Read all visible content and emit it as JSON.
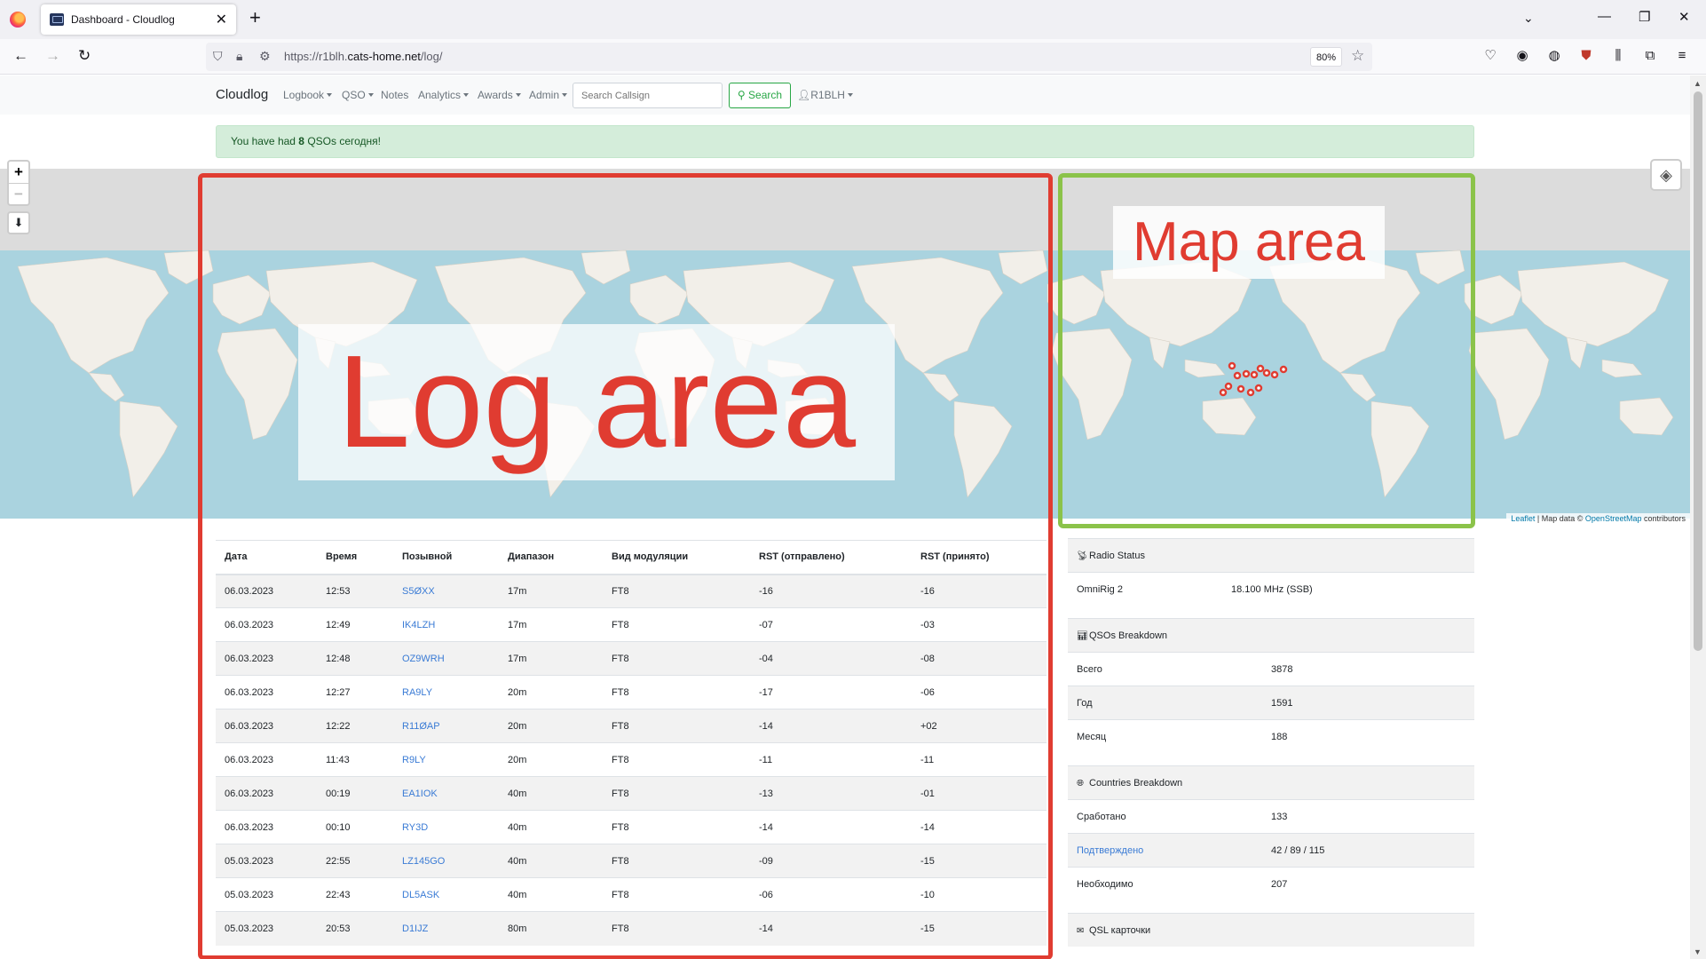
{
  "browser": {
    "tab_title": "Dashboard - Cloudlog",
    "url_prefix": "https://r1blh.",
    "url_domain": "cats-home.net",
    "url_path": "/log/",
    "zoom": "80%"
  },
  "nav": {
    "brand": "Cloudlog",
    "menus": [
      "Logbook",
      "QSO",
      "Notes",
      "Analytics",
      "Awards",
      "Admin"
    ],
    "search_placeholder": "Search Callsign",
    "search_button": "Search",
    "user": "R1BLH"
  },
  "alert": {
    "prefix": "You have had ",
    "count": "8",
    "suffix": " QSOs сегодня!"
  },
  "overlays": {
    "log_label": "Log area",
    "map_label": "Map area"
  },
  "map": {
    "attribution_leaflet": "Leaflet",
    "attribution_mid": " | Map data © ",
    "attribution_osm": "OpenStreetMap",
    "attribution_end": " contributors",
    "colors": {
      "ocean": "#aad3df",
      "land": "#f2efe9",
      "marker": "#e03c31"
    }
  },
  "log": {
    "headers": [
      "Дата",
      "Время",
      "Позывной",
      "Диапазон",
      "Вид модуляции",
      "RST (отправлено)",
      "RST (принято)"
    ],
    "rows": [
      [
        "06.03.2023",
        "12:53",
        "S5ØXX",
        "17m",
        "FT8",
        "-16",
        "-16"
      ],
      [
        "06.03.2023",
        "12:49",
        "IK4LZH",
        "17m",
        "FT8",
        "-07",
        "-03"
      ],
      [
        "06.03.2023",
        "12:48",
        "OZ9WRH",
        "17m",
        "FT8",
        "-04",
        "-08"
      ],
      [
        "06.03.2023",
        "12:27",
        "RA9LY",
        "20m",
        "FT8",
        "-17",
        "-06"
      ],
      [
        "06.03.2023",
        "12:22",
        "R11ØAP",
        "20m",
        "FT8",
        "-14",
        "+02"
      ],
      [
        "06.03.2023",
        "11:43",
        "R9LY",
        "20m",
        "FT8",
        "-11",
        "-11"
      ],
      [
        "06.03.2023",
        "00:19",
        "EA1IOK",
        "40m",
        "FT8",
        "-13",
        "-01"
      ],
      [
        "06.03.2023",
        "00:10",
        "RY3D",
        "40m",
        "FT8",
        "-14",
        "-14"
      ],
      [
        "05.03.2023",
        "22:55",
        "LZ145GO",
        "40m",
        "FT8",
        "-09",
        "-15"
      ],
      [
        "05.03.2023",
        "22:43",
        "DL5ASK",
        "40m",
        "FT8",
        "-06",
        "-10"
      ],
      [
        "05.03.2023",
        "20:53",
        "D1IJZ",
        "80m",
        "FT8",
        "-14",
        "-15"
      ]
    ]
  },
  "radio": {
    "title": "Radio Status",
    "name": "OmniRig 2",
    "value": "18.100 MHz (SSB)"
  },
  "qsos": {
    "title": "QSOs Breakdown",
    "rows": [
      {
        "label": "Всего",
        "value": "3878"
      },
      {
        "label": "Год",
        "value": "1591"
      },
      {
        "label": "Месяц",
        "value": "188"
      }
    ]
  },
  "countries": {
    "title": "Countries Breakdown",
    "worked_label": "Сработано",
    "worked_value": "133",
    "confirmed_label": "Подтверждено",
    "confirmed_value": "42 / 89 / 115",
    "needed_label": "Необходимо",
    "needed_value": "207"
  },
  "qsl": {
    "title": "QSL карточки"
  }
}
